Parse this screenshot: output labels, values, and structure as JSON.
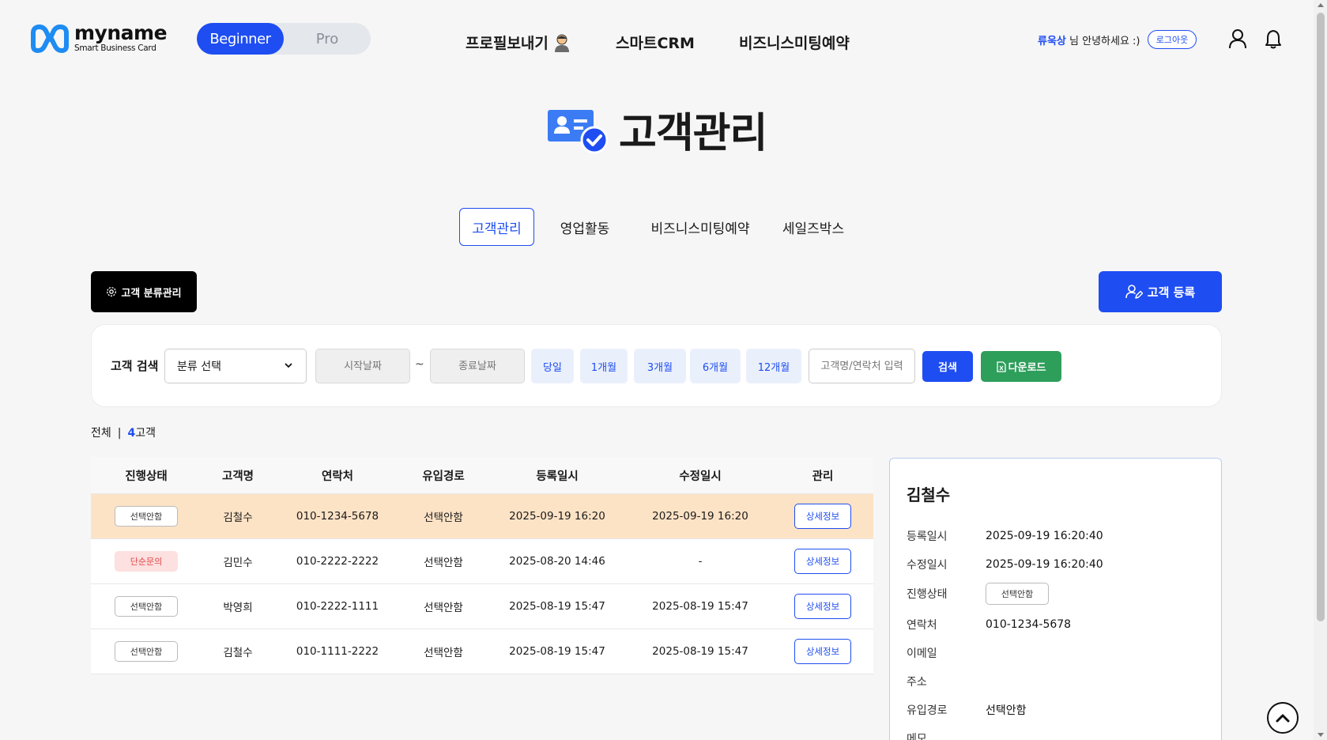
{
  "header": {
    "logo_name": "myname",
    "logo_sub": "Smart Business Card",
    "modes": [
      "Beginner",
      "Pro"
    ],
    "active_mode": "Beginner",
    "nav": [
      "프로필보내기",
      "스마트CRM",
      "비즈니스미팅예약"
    ],
    "user_name": "류욱상",
    "greeting": " 님 안녕하세요 :)",
    "logout_label": "로그아웃"
  },
  "page": {
    "title": "고객관리"
  },
  "tabs": [
    "고객관리",
    "영업활동",
    "비즈니스미팅예약",
    "세일즈박스"
  ],
  "actions": {
    "category_label": "고객 분류관리",
    "register_label": "고객 등록"
  },
  "search": {
    "label": "고객 검색",
    "category_select": "분류 선택",
    "start_placeholder": "시작날짜",
    "end_placeholder": "종료날짜",
    "tilde": "~",
    "periods": [
      "당일",
      "1개월",
      "3개월",
      "6개월",
      "12개월"
    ],
    "keyword_placeholder": "고객명/연락처 입력",
    "search_label": "검색",
    "download_label": "다운로드"
  },
  "summary": {
    "all_label": "전체",
    "separator": "|",
    "count": "4",
    "unit": "고객"
  },
  "table": {
    "headers": [
      "진행상태",
      "고객명",
      "연락처",
      "유입경로",
      "등록일시",
      "수정일시",
      "관리"
    ],
    "detail_label": "상세정보",
    "rows": [
      {
        "status": "선택안함",
        "status_type": "default",
        "name": "김철수",
        "phone": "010-1234-5678",
        "source": "선택안함",
        "created": "2025-09-19 16:20",
        "updated": "2025-09-19 16:20",
        "selected": true
      },
      {
        "status": "단순문의",
        "status_type": "pink",
        "name": "김민수",
        "phone": "010-2222-2222",
        "source": "선택안함",
        "created": "2025-08-20 14:46",
        "updated": "-",
        "selected": false
      },
      {
        "status": "선택안함",
        "status_type": "default",
        "name": "박영희",
        "phone": "010-2222-1111",
        "source": "선택안함",
        "created": "2025-08-19 15:47",
        "updated": "2025-08-19 15:47",
        "selected": false
      },
      {
        "status": "선택안함",
        "status_type": "default",
        "name": "김철수",
        "phone": "010-1111-2222",
        "source": "선택안함",
        "created": "2025-08-19 15:47",
        "updated": "2025-08-19 15:47",
        "selected": false
      }
    ]
  },
  "detail": {
    "name": "김철수",
    "fields": [
      {
        "label": "등록일시",
        "value": "2025-09-19 16:20:40"
      },
      {
        "label": "수정일시",
        "value": "2025-09-19 16:20:40"
      },
      {
        "label": "진행상태",
        "value": "선택안함",
        "badge": true
      },
      {
        "label": "연락처",
        "value": "010-1234-5678"
      },
      {
        "label": "이메일",
        "value": ""
      },
      {
        "label": "주소",
        "value": ""
      },
      {
        "label": "유입경로",
        "value": "선택안함"
      },
      {
        "label": "메모",
        "value": ""
      }
    ]
  },
  "colors": {
    "accent": "#1e4df2",
    "download": "#2e9e5b",
    "selected_row": "#fde3c6",
    "pink_badge": "#fde0e0"
  }
}
